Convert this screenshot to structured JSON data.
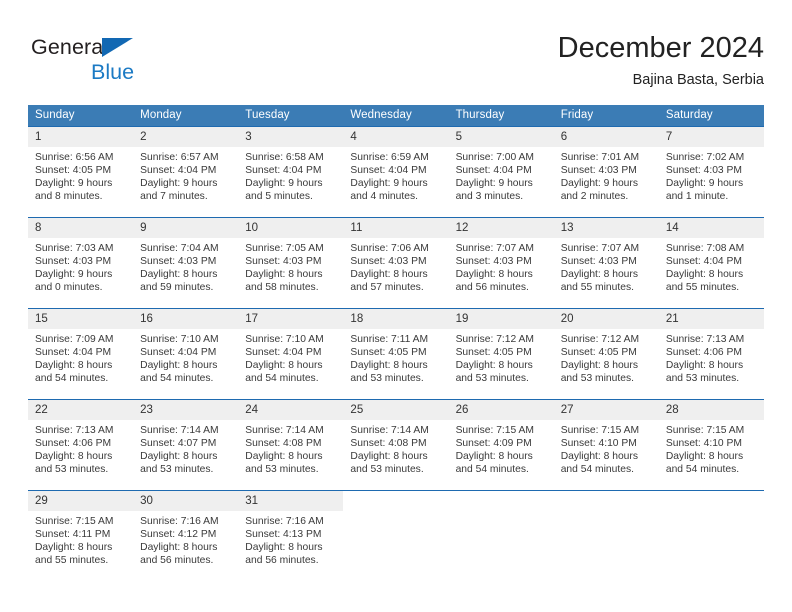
{
  "brand": {
    "name_part1": "General",
    "name_part2": "Blue",
    "triangle_icon": "blue-triangle-icon",
    "color_dark": "#231f20",
    "color_blue": "#1b7ac4"
  },
  "header": {
    "title": "December 2024",
    "subtitle": "Bajina Basta, Serbia"
  },
  "theme": {
    "header_bar": "#3b7cb5",
    "row_divider": "#1e6ab0",
    "daynum_band": "#efefef",
    "text": "#3a3a3a"
  },
  "weekday_headers": [
    "Sunday",
    "Monday",
    "Tuesday",
    "Wednesday",
    "Thursday",
    "Friday",
    "Saturday"
  ],
  "weeks": [
    [
      {
        "day": "1",
        "sunrise": "Sunrise: 6:56 AM",
        "sunset": "Sunset: 4:05 PM",
        "daylight_1": "Daylight: 9 hours",
        "daylight_2": "and 8 minutes."
      },
      {
        "day": "2",
        "sunrise": "Sunrise: 6:57 AM",
        "sunset": "Sunset: 4:04 PM",
        "daylight_1": "Daylight: 9 hours",
        "daylight_2": "and 7 minutes."
      },
      {
        "day": "3",
        "sunrise": "Sunrise: 6:58 AM",
        "sunset": "Sunset: 4:04 PM",
        "daylight_1": "Daylight: 9 hours",
        "daylight_2": "and 5 minutes."
      },
      {
        "day": "4",
        "sunrise": "Sunrise: 6:59 AM",
        "sunset": "Sunset: 4:04 PM",
        "daylight_1": "Daylight: 9 hours",
        "daylight_2": "and 4 minutes."
      },
      {
        "day": "5",
        "sunrise": "Sunrise: 7:00 AM",
        "sunset": "Sunset: 4:04 PM",
        "daylight_1": "Daylight: 9 hours",
        "daylight_2": "and 3 minutes."
      },
      {
        "day": "6",
        "sunrise": "Sunrise: 7:01 AM",
        "sunset": "Sunset: 4:03 PM",
        "daylight_1": "Daylight: 9 hours",
        "daylight_2": "and 2 minutes."
      },
      {
        "day": "7",
        "sunrise": "Sunrise: 7:02 AM",
        "sunset": "Sunset: 4:03 PM",
        "daylight_1": "Daylight: 9 hours",
        "daylight_2": "and 1 minute."
      }
    ],
    [
      {
        "day": "8",
        "sunrise": "Sunrise: 7:03 AM",
        "sunset": "Sunset: 4:03 PM",
        "daylight_1": "Daylight: 9 hours",
        "daylight_2": "and 0 minutes."
      },
      {
        "day": "9",
        "sunrise": "Sunrise: 7:04 AM",
        "sunset": "Sunset: 4:03 PM",
        "daylight_1": "Daylight: 8 hours",
        "daylight_2": "and 59 minutes."
      },
      {
        "day": "10",
        "sunrise": "Sunrise: 7:05 AM",
        "sunset": "Sunset: 4:03 PM",
        "daylight_1": "Daylight: 8 hours",
        "daylight_2": "and 58 minutes."
      },
      {
        "day": "11",
        "sunrise": "Sunrise: 7:06 AM",
        "sunset": "Sunset: 4:03 PM",
        "daylight_1": "Daylight: 8 hours",
        "daylight_2": "and 57 minutes."
      },
      {
        "day": "12",
        "sunrise": "Sunrise: 7:07 AM",
        "sunset": "Sunset: 4:03 PM",
        "daylight_1": "Daylight: 8 hours",
        "daylight_2": "and 56 minutes."
      },
      {
        "day": "13",
        "sunrise": "Sunrise: 7:07 AM",
        "sunset": "Sunset: 4:03 PM",
        "daylight_1": "Daylight: 8 hours",
        "daylight_2": "and 55 minutes."
      },
      {
        "day": "14",
        "sunrise": "Sunrise: 7:08 AM",
        "sunset": "Sunset: 4:04 PM",
        "daylight_1": "Daylight: 8 hours",
        "daylight_2": "and 55 minutes."
      }
    ],
    [
      {
        "day": "15",
        "sunrise": "Sunrise: 7:09 AM",
        "sunset": "Sunset: 4:04 PM",
        "daylight_1": "Daylight: 8 hours",
        "daylight_2": "and 54 minutes."
      },
      {
        "day": "16",
        "sunrise": "Sunrise: 7:10 AM",
        "sunset": "Sunset: 4:04 PM",
        "daylight_1": "Daylight: 8 hours",
        "daylight_2": "and 54 minutes."
      },
      {
        "day": "17",
        "sunrise": "Sunrise: 7:10 AM",
        "sunset": "Sunset: 4:04 PM",
        "daylight_1": "Daylight: 8 hours",
        "daylight_2": "and 54 minutes."
      },
      {
        "day": "18",
        "sunrise": "Sunrise: 7:11 AM",
        "sunset": "Sunset: 4:05 PM",
        "daylight_1": "Daylight: 8 hours",
        "daylight_2": "and 53 minutes."
      },
      {
        "day": "19",
        "sunrise": "Sunrise: 7:12 AM",
        "sunset": "Sunset: 4:05 PM",
        "daylight_1": "Daylight: 8 hours",
        "daylight_2": "and 53 minutes."
      },
      {
        "day": "20",
        "sunrise": "Sunrise: 7:12 AM",
        "sunset": "Sunset: 4:05 PM",
        "daylight_1": "Daylight: 8 hours",
        "daylight_2": "and 53 minutes."
      },
      {
        "day": "21",
        "sunrise": "Sunrise: 7:13 AM",
        "sunset": "Sunset: 4:06 PM",
        "daylight_1": "Daylight: 8 hours",
        "daylight_2": "and 53 minutes."
      }
    ],
    [
      {
        "day": "22",
        "sunrise": "Sunrise: 7:13 AM",
        "sunset": "Sunset: 4:06 PM",
        "daylight_1": "Daylight: 8 hours",
        "daylight_2": "and 53 minutes."
      },
      {
        "day": "23",
        "sunrise": "Sunrise: 7:14 AM",
        "sunset": "Sunset: 4:07 PM",
        "daylight_1": "Daylight: 8 hours",
        "daylight_2": "and 53 minutes."
      },
      {
        "day": "24",
        "sunrise": "Sunrise: 7:14 AM",
        "sunset": "Sunset: 4:08 PM",
        "daylight_1": "Daylight: 8 hours",
        "daylight_2": "and 53 minutes."
      },
      {
        "day": "25",
        "sunrise": "Sunrise: 7:14 AM",
        "sunset": "Sunset: 4:08 PM",
        "daylight_1": "Daylight: 8 hours",
        "daylight_2": "and 53 minutes."
      },
      {
        "day": "26",
        "sunrise": "Sunrise: 7:15 AM",
        "sunset": "Sunset: 4:09 PM",
        "daylight_1": "Daylight: 8 hours",
        "daylight_2": "and 54 minutes."
      },
      {
        "day": "27",
        "sunrise": "Sunrise: 7:15 AM",
        "sunset": "Sunset: 4:10 PM",
        "daylight_1": "Daylight: 8 hours",
        "daylight_2": "and 54 minutes."
      },
      {
        "day": "28",
        "sunrise": "Sunrise: 7:15 AM",
        "sunset": "Sunset: 4:10 PM",
        "daylight_1": "Daylight: 8 hours",
        "daylight_2": "and 54 minutes."
      }
    ],
    [
      {
        "day": "29",
        "sunrise": "Sunrise: 7:15 AM",
        "sunset": "Sunset: 4:11 PM",
        "daylight_1": "Daylight: 8 hours",
        "daylight_2": "and 55 minutes."
      },
      {
        "day": "30",
        "sunrise": "Sunrise: 7:16 AM",
        "sunset": "Sunset: 4:12 PM",
        "daylight_1": "Daylight: 8 hours",
        "daylight_2": "and 56 minutes."
      },
      {
        "day": "31",
        "sunrise": "Sunrise: 7:16 AM",
        "sunset": "Sunset: 4:13 PM",
        "daylight_1": "Daylight: 8 hours",
        "daylight_2": "and 56 minutes."
      },
      {
        "day": "",
        "sunrise": "",
        "sunset": "",
        "daylight_1": "",
        "daylight_2": ""
      },
      {
        "day": "",
        "sunrise": "",
        "sunset": "",
        "daylight_1": "",
        "daylight_2": ""
      },
      {
        "day": "",
        "sunrise": "",
        "sunset": "",
        "daylight_1": "",
        "daylight_2": ""
      },
      {
        "day": "",
        "sunrise": "",
        "sunset": "",
        "daylight_1": "",
        "daylight_2": ""
      }
    ]
  ]
}
